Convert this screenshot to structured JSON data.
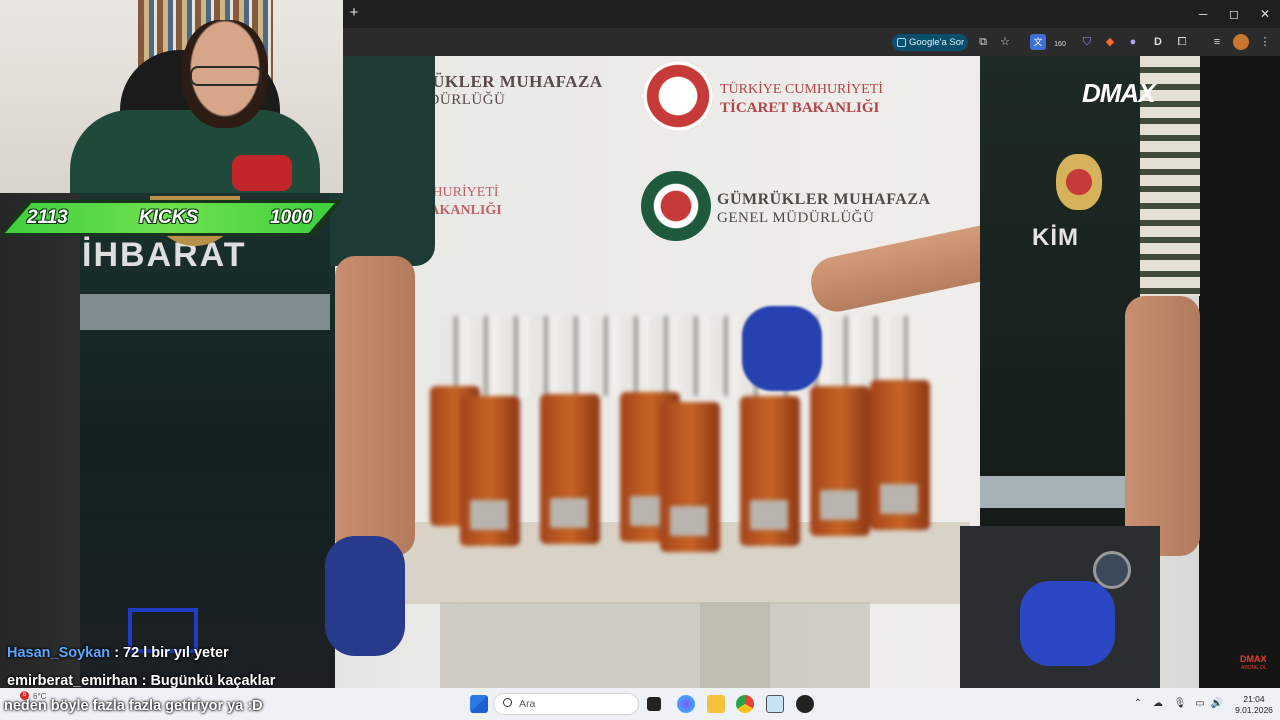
{
  "browser": {
    "new_tab_label": "+",
    "window_controls": {
      "minimize": "─",
      "maximize": "◻",
      "close": "✕"
    },
    "sor_button": "Google'a Sor",
    "extension_badge": "160",
    "extension_letter": "D",
    "icons": [
      "cast-icon",
      "star-icon",
      "translate-icon",
      "extension-icon",
      "shield-icon",
      "fox-icon",
      "cloud-icon",
      "d-extension-icon",
      "puzzle-icon",
      "list-icon",
      "profile-icon",
      "menu-icon"
    ]
  },
  "video": {
    "wall": {
      "line1a": "GÜMRÜKLER MUHAFAZA",
      "line1b": "GENEL MÜDÜRLÜĞÜ",
      "top_left_a": "ÜMRÜKLER MUHAFAZA",
      "top_left_b": "L MÜDÜRLÜĞÜ",
      "ministry_a": "TÜRKİYE CUMHURİYETİ",
      "ministry_b": "TİCARET BAKANLIĞI",
      "ministry_left_a": "MHURİYETİ",
      "ministry_left_b": "BAKANLIĞI"
    },
    "vest_left": "İHBARAT",
    "vest_right": "KİM",
    "channel_logo": "DMAX",
    "corner_logo": "DMAX",
    "corner_sub": "ABONE OL"
  },
  "overlay": {
    "kicks_left": "2113",
    "kicks_label": "KICKS",
    "kicks_right": "1000"
  },
  "chat": [
    {
      "user": "Hasan_Soykan",
      "message": ": 72 l bir yıl yeter"
    },
    {
      "user": "emirberat_emirhan",
      "message": ": Bugünkü kaçaklar"
    },
    {
      "user": "",
      "message": "neden böyle fazla fazla getiriyor ya :D"
    }
  ],
  "taskbar": {
    "weather_temp": "6°C",
    "weather_badge": "6",
    "search_placeholder": "Ara",
    "time": "21:04",
    "date": "9.01.2026"
  },
  "colors": {
    "kicks_green": "#3fcf3e",
    "dmax_red": "#e23d2d",
    "chat_user_blue": "#5da8ff",
    "sor_bg": "#0b4e6b"
  }
}
